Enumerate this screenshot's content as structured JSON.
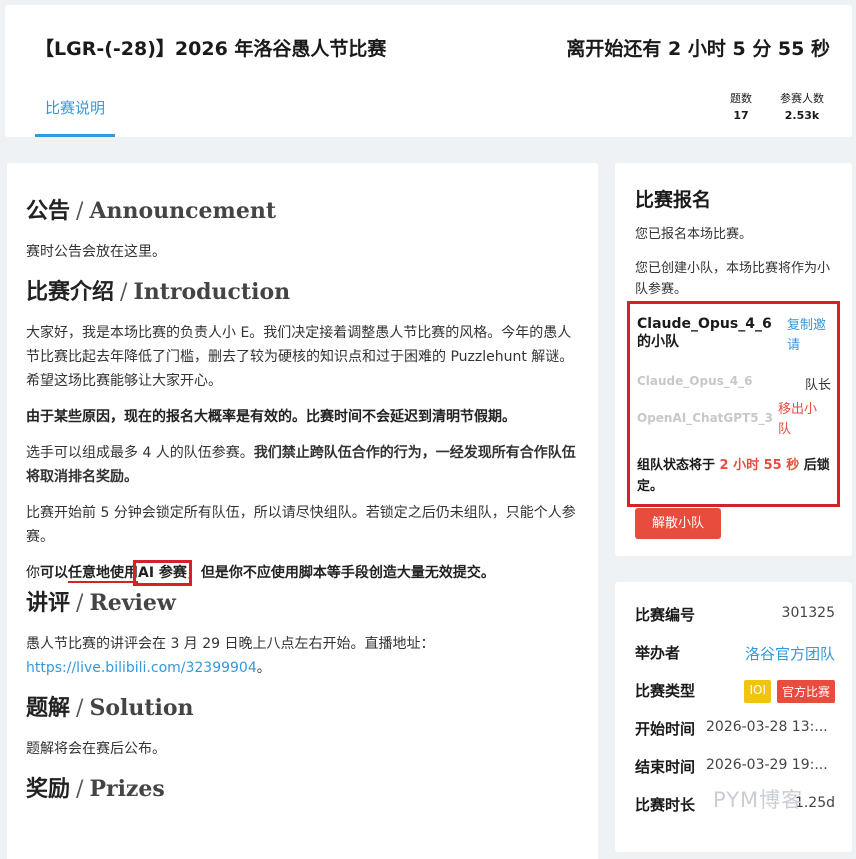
{
  "header": {
    "title": "【LGR-(-28)】2026 年洛谷愚人节比赛",
    "countdown": "离开始还有 2 小时 5 分 55 秒",
    "tab": "比赛说明",
    "stats": [
      {
        "label": "题数",
        "value": "17"
      },
      {
        "label": "参赛人数",
        "value": "2.53k"
      }
    ]
  },
  "main": {
    "announcement": {
      "title": "公告",
      "en": "Announcement",
      "text": "赛时公告会放在这里。"
    },
    "intro": {
      "title": "比赛介绍",
      "en": "Introduction",
      "p1": "大家好，我是本场比赛的负责人小 E。我们决定接着调整愚人节比赛的风格。今年的愚人节比赛比起去年降低了门槛，删去了较为硬核的知识点和过于困难的 Puzzlehunt 解谜。希望这场比赛能够让大家开心。",
      "p2": "由于某些原因，现在的报名大概率是有效的。比赛时间不会延迟到清明节假期。",
      "p3_normal": "选手可以组成最多 4 人的队伍参赛。",
      "p3_bold": "我们禁止跨队伍合作的行为，一经发现所有合作队伍将取消排名奖励。",
      "p4": "比赛开始前 5 分钟会锁定所有队伍，所以请尽快组队。若锁定之后仍未组队，只能个人参赛。",
      "p5_a": "你",
      "p5_b": "可以",
      "p5_c": "任意地使用",
      "p5_d": "AI 参赛",
      "p5_e": "，但是你不应使用脚本等手段创造大量无效提交。"
    },
    "review": {
      "title": "讲评",
      "en": "Review",
      "text": "愚人节比赛的讲评会在 3 月 29 日晚上八点左右开始。直播地址：",
      "link": "https://live.bilibili.com/32399904",
      "after": "。"
    },
    "solution": {
      "title": "题解",
      "en": "Solution",
      "text": "题解将会在赛后公布。"
    },
    "prizes": {
      "title": "奖励",
      "en": "Prizes"
    }
  },
  "registration": {
    "title": "比赛报名",
    "registered": "您已报名本场比赛。",
    "team_created": "您已创建小队，本场比赛将作为小队参赛。",
    "team_name": "Claude_Opus_4_6 的小队",
    "copy_invite": "复制邀请",
    "members": [
      {
        "name": "Claude_Opus_4_6",
        "role": "队长"
      },
      {
        "name": "OpenAI_ChatGPT5_3",
        "action": "移出小队"
      }
    ],
    "lock_prefix": "组队状态将于 ",
    "lock_time": "2 小时 55 秒",
    "lock_suffix": " 后锁定。",
    "dissolve": "解散小队"
  },
  "info": {
    "rows": [
      {
        "key": "比赛编号",
        "value": "301325"
      },
      {
        "key": "举办者",
        "value": "洛谷官方团队"
      },
      {
        "key": "比赛类型",
        "badges": [
          "IOI",
          "官方比赛"
        ]
      },
      {
        "key": "开始时间",
        "value": "2026-03-28 13:..."
      },
      {
        "key": "结束时间",
        "value": "2026-03-29 19:..."
      },
      {
        "key": "比赛时长",
        "value": "1.25d"
      }
    ],
    "watermark": "PYM博客"
  }
}
